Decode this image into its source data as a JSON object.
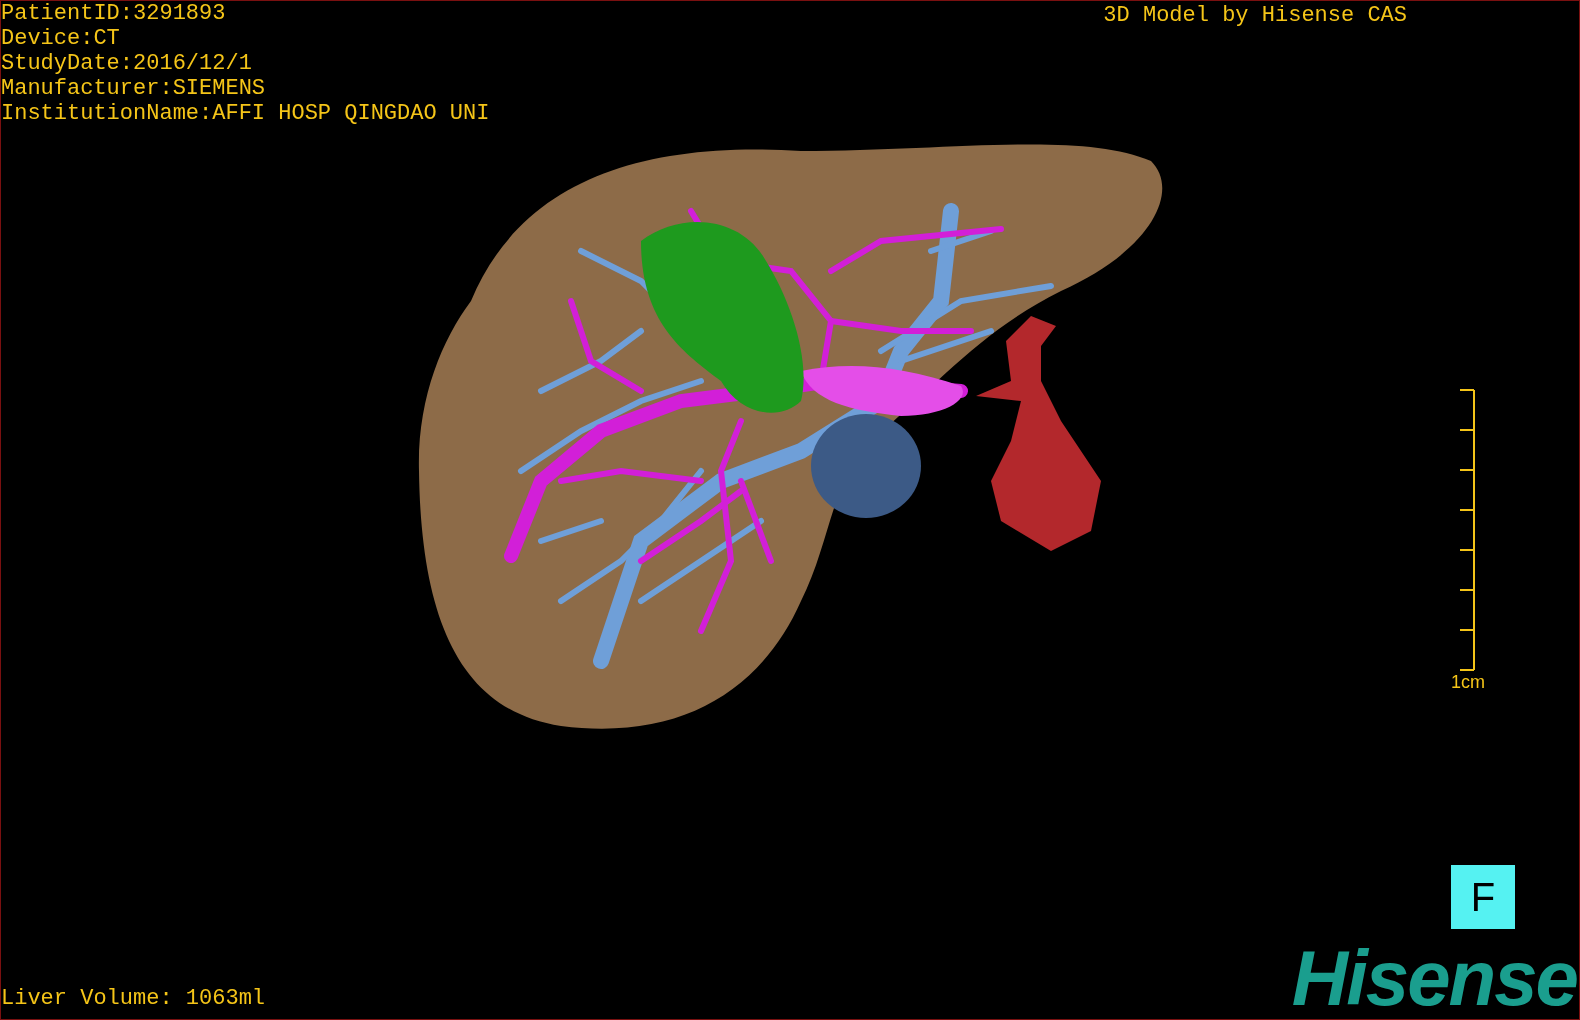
{
  "patient_info": [
    "PatientID:3291893",
    "Device:CT",
    "StudyDate:2016/12/1",
    "Manufacturer:SIEMENS",
    "InstitutionName:AFFI HOSP QINGDAO UNI"
  ],
  "caption": "3D Model by Hisense CAS",
  "scale_bar": {
    "label": "1cm"
  },
  "view_button": {
    "label": "F"
  },
  "logo": "Hisense",
  "liver_volume": "Liver Volume: 1063ml"
}
